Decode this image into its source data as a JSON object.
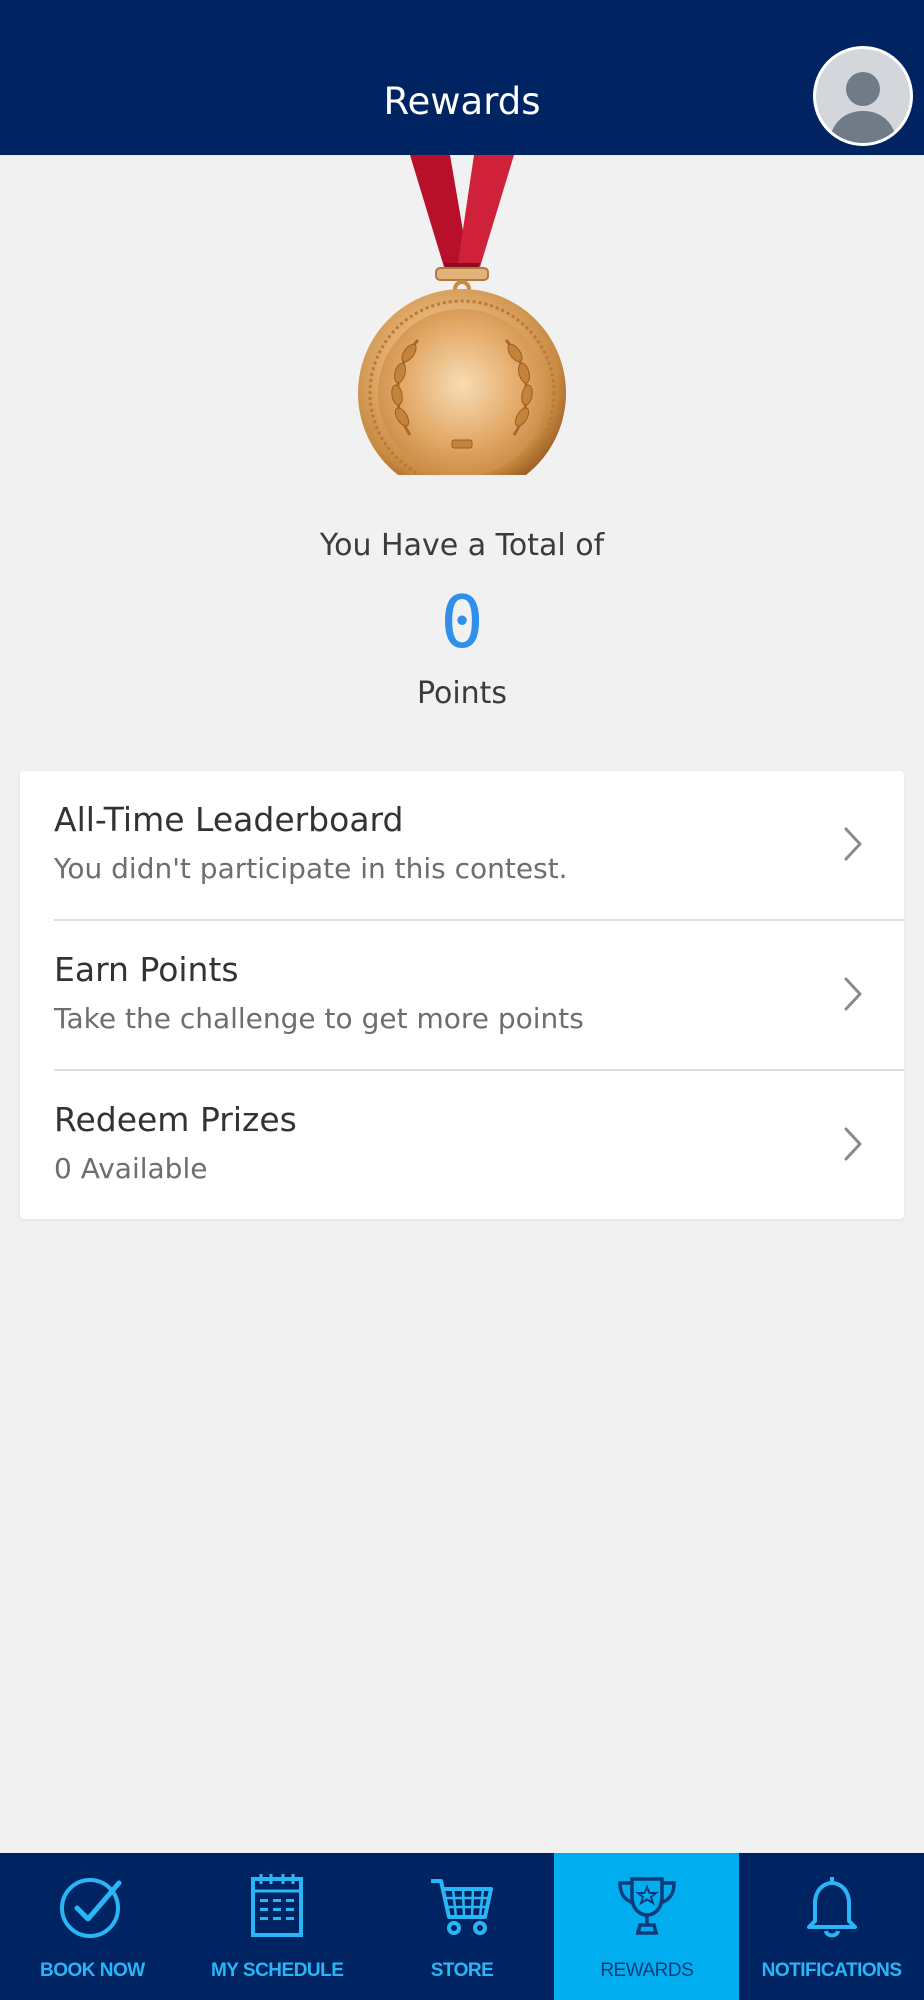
{
  "header": {
    "title": "Rewards"
  },
  "summary": {
    "total_label": "You Have a Total of",
    "points": "0",
    "points_unit": "Points"
  },
  "menu": [
    {
      "title": "All-Time Leaderboard",
      "subtitle": "You didn't participate in this contest."
    },
    {
      "title": "Earn Points",
      "subtitle": "Take the challenge to get more points"
    },
    {
      "title": "Redeem Prizes",
      "subtitle": "0 Available"
    }
  ],
  "tabs": [
    {
      "label": "BOOK NOW",
      "icon": "check-circle-icon"
    },
    {
      "label": "MY SCHEDULE",
      "icon": "calendar-icon"
    },
    {
      "label": "STORE",
      "icon": "cart-icon"
    },
    {
      "label": "REWARDS",
      "icon": "trophy-icon",
      "active": true
    },
    {
      "label": "NOTIFICATIONS",
      "icon": "bell-icon"
    }
  ],
  "colors": {
    "navy": "#002462",
    "accent": "#00aeef",
    "points": "#2f8fea"
  }
}
